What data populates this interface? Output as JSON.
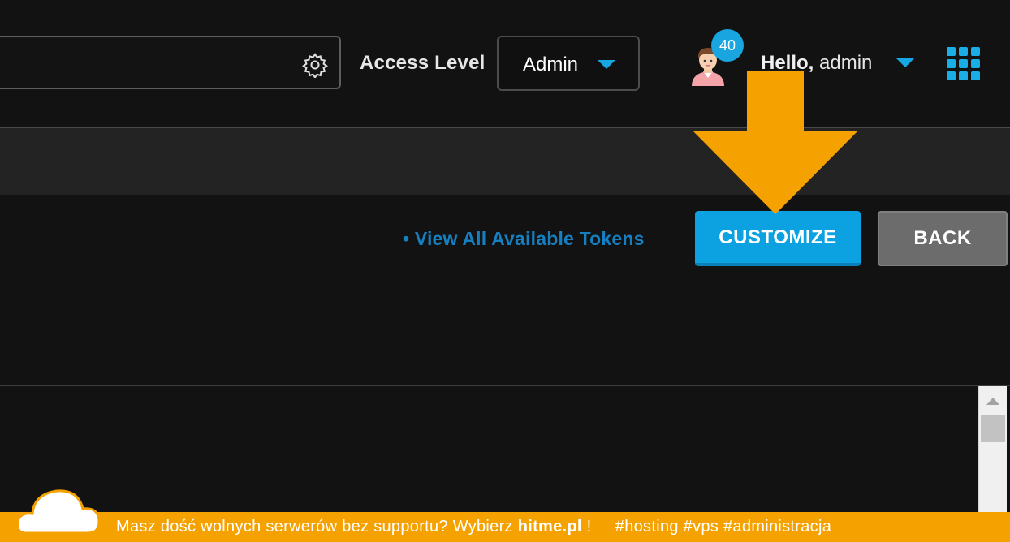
{
  "header": {
    "access_level_label": "Access Level",
    "access_level_value": "Admin",
    "notification_count": "40",
    "greeting_bold": "Hello,",
    "greeting_user": " admin"
  },
  "actions": {
    "tokens_link": "• View All Available Tokens",
    "customize_label": "CUSTOMIZE",
    "back_label": "BACK"
  },
  "footer": {
    "text_before": "Masz dość wolnych serwerów bez supportu? Wybierz ",
    "brand": "hitme.pl",
    "text_after": " !     #hosting #vps #administracja"
  },
  "colors": {
    "accent_blue": "#0ca2e2",
    "arrow_orange": "#f5a200",
    "background": "#121212"
  },
  "icons": [
    "gear-icon",
    "chevron-down-icon",
    "avatar",
    "apps-grid-icon",
    "arrow-down-icon",
    "cloud-logo-icon"
  ]
}
